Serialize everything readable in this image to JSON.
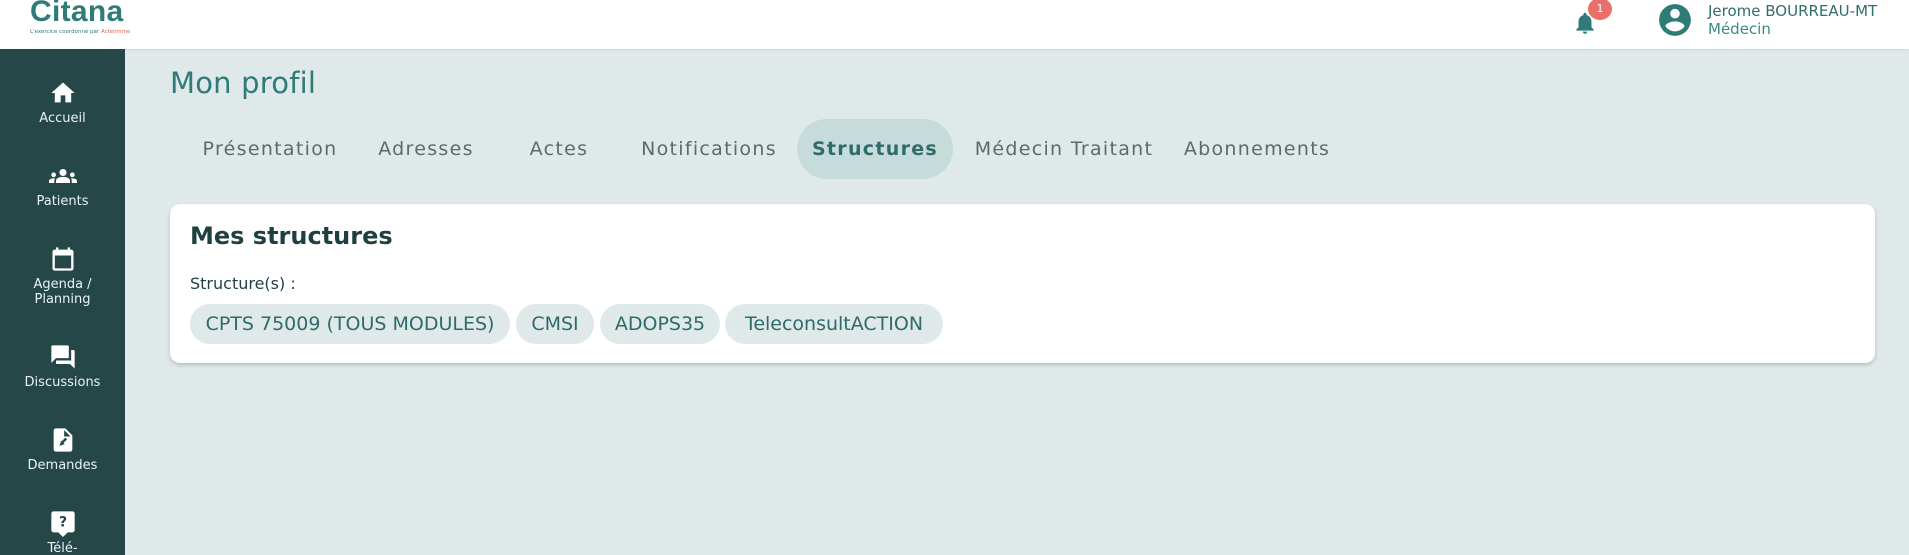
{
  "header": {
    "logo_text": "Citana",
    "logo_tagline": "L'exercice coordonné par",
    "logo_tagline_brand": "Actelimme",
    "notifications_badge": "1",
    "user_name": "Jerome BOURREAU-MT",
    "user_role": "Médecin",
    "icons": {
      "bell": "bell-icon",
      "avatar": "account-circle-icon"
    }
  },
  "sidebar": {
    "items": [
      {
        "label": "Accueil",
        "icon": "home-icon"
      },
      {
        "label": "Patients",
        "icon": "group-icon"
      },
      {
        "label": "Agenda /",
        "label2": "Planning",
        "icon": "calendar-icon"
      },
      {
        "label": "Discussions",
        "icon": "chat-icon"
      },
      {
        "label": "Demandes",
        "icon": "document-icon"
      },
      {
        "label": "Télé-",
        "icon": "help-icon"
      }
    ]
  },
  "main": {
    "title": "Mon profil",
    "tabs": [
      {
        "label": "Présentation",
        "active": false
      },
      {
        "label": "Adresses",
        "active": false
      },
      {
        "label": "Actes",
        "active": false
      },
      {
        "label": "Notifications",
        "active": false
      },
      {
        "label": "Structures",
        "active": true
      },
      {
        "label": "Médecin Traitant",
        "active": false
      },
      {
        "label": "Abonnements",
        "active": false
      }
    ],
    "card": {
      "title": "Mes structures",
      "structures_label": "Structure(s) :",
      "chips": [
        "CPTS 75009 (TOUS MODULES)",
        "CMSI",
        "ADOPS35",
        "TeleconsultACTION"
      ]
    }
  },
  "colors": {
    "sidebar_bg": "#254748",
    "page_bg": "#dfe9ea",
    "accent": "#2e7b78",
    "badge": "#e9706a",
    "tab_active_bg": "#c6dcdb",
    "chip_bg": "#dfe9ea"
  }
}
